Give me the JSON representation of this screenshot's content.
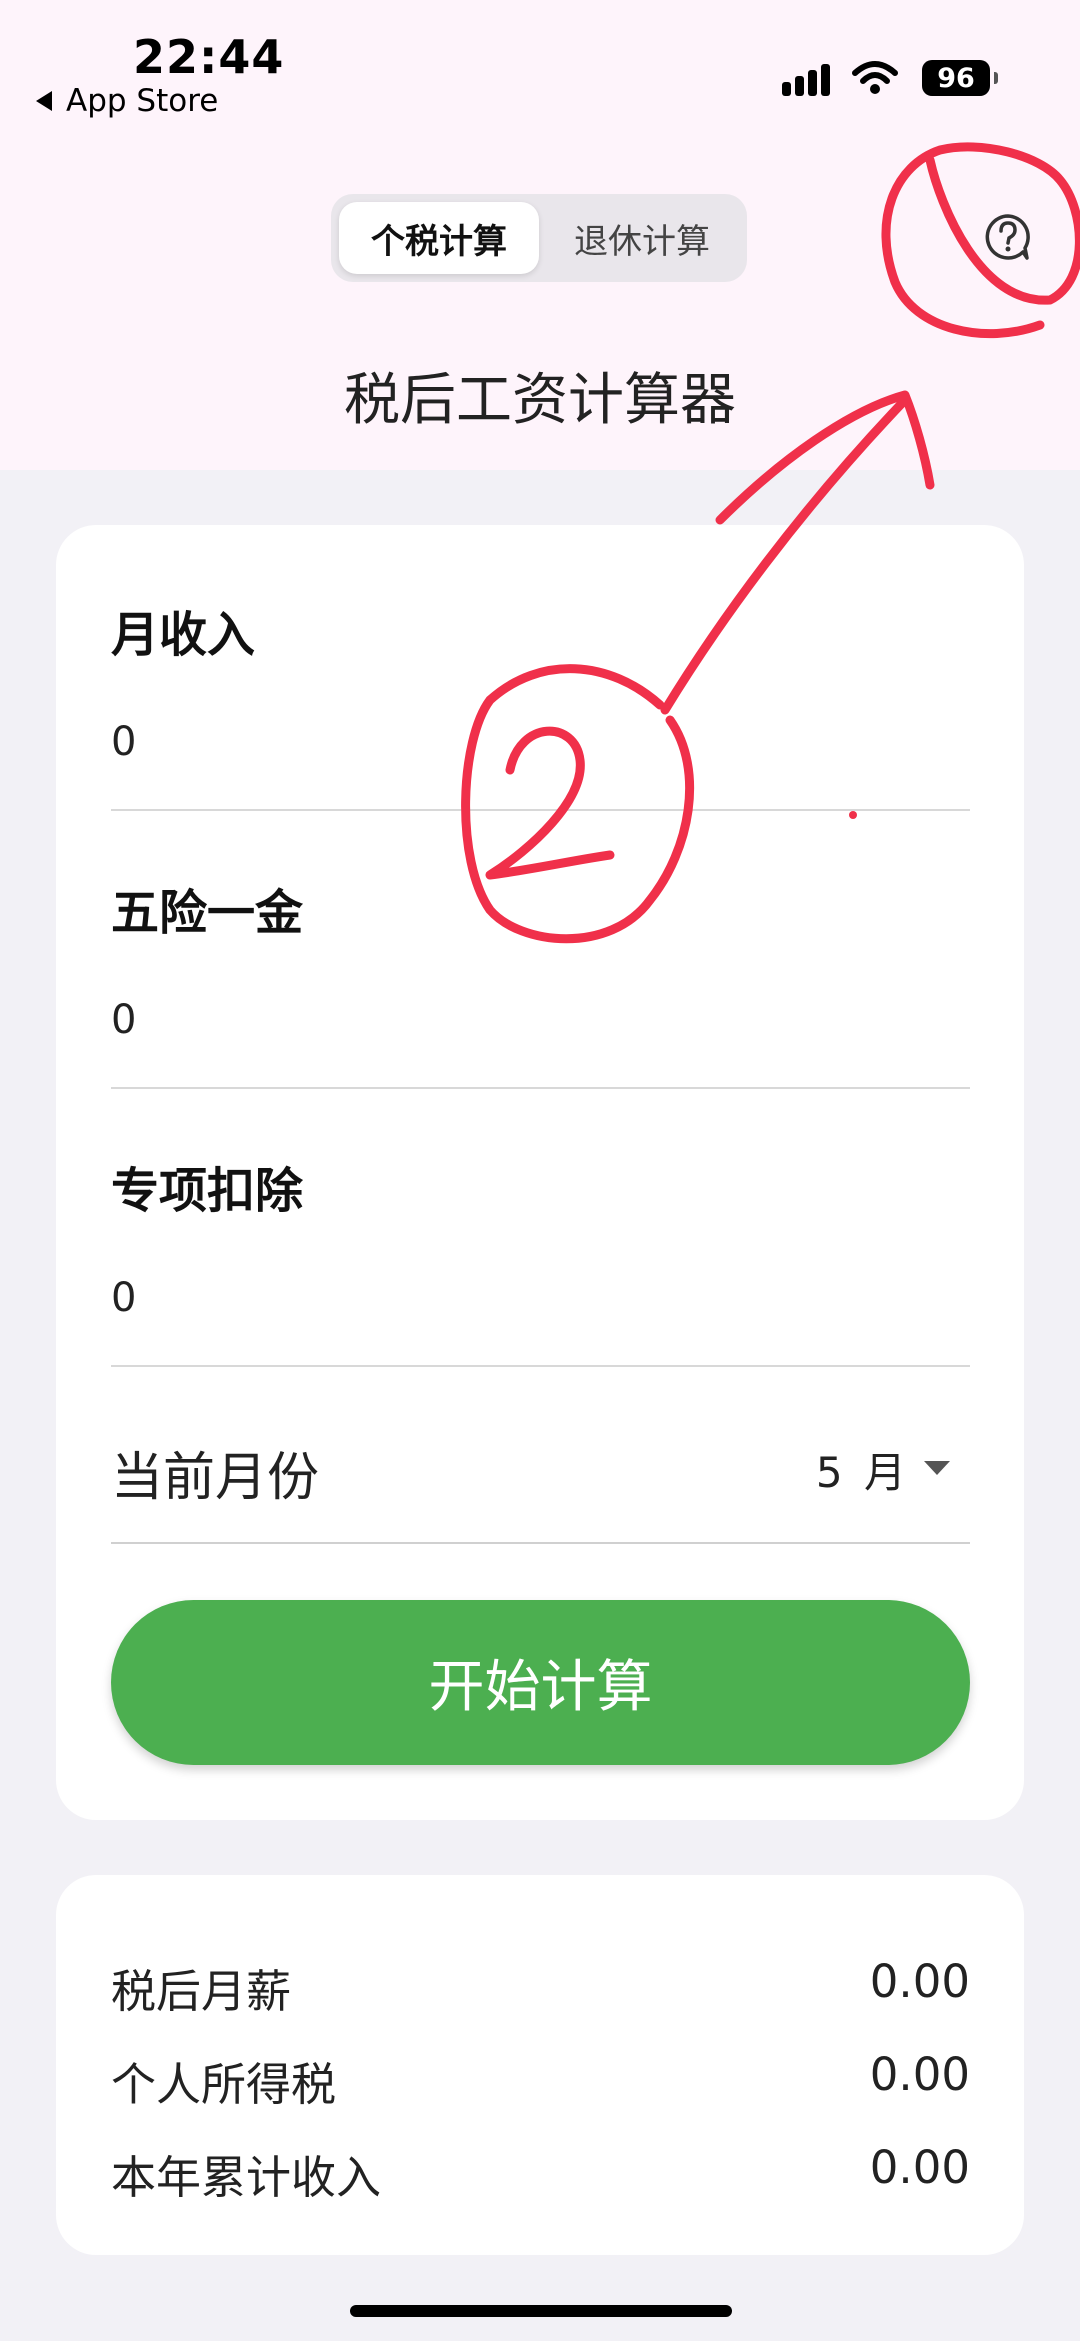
{
  "status_bar": {
    "time": "22:44",
    "back_label": "App Store",
    "battery": "96"
  },
  "segmented": {
    "tabs": [
      {
        "label": "个税计算"
      },
      {
        "label": "退休计算"
      }
    ],
    "selected": "个税计算"
  },
  "header": {
    "title": "税后工资计算器",
    "help_icon": "question-circle-icon"
  },
  "form": {
    "fields": [
      {
        "label": "月收入",
        "value": "0"
      },
      {
        "label": "五险一金",
        "value": "0"
      },
      {
        "label": "专项扣除",
        "value": "0"
      }
    ],
    "month": {
      "label": "当前月份",
      "value": "5 月"
    },
    "submit_label": "开始计算"
  },
  "results": [
    {
      "label": "税后月薪",
      "value": "0.00"
    },
    {
      "label": "个人所得税",
      "value": "0.00"
    },
    {
      "label": "本年累计收入",
      "value": "0.00"
    }
  ],
  "colors": {
    "accent": "#4caf50",
    "header_bg": "#fef4fb",
    "annotation": "#f0304a"
  }
}
